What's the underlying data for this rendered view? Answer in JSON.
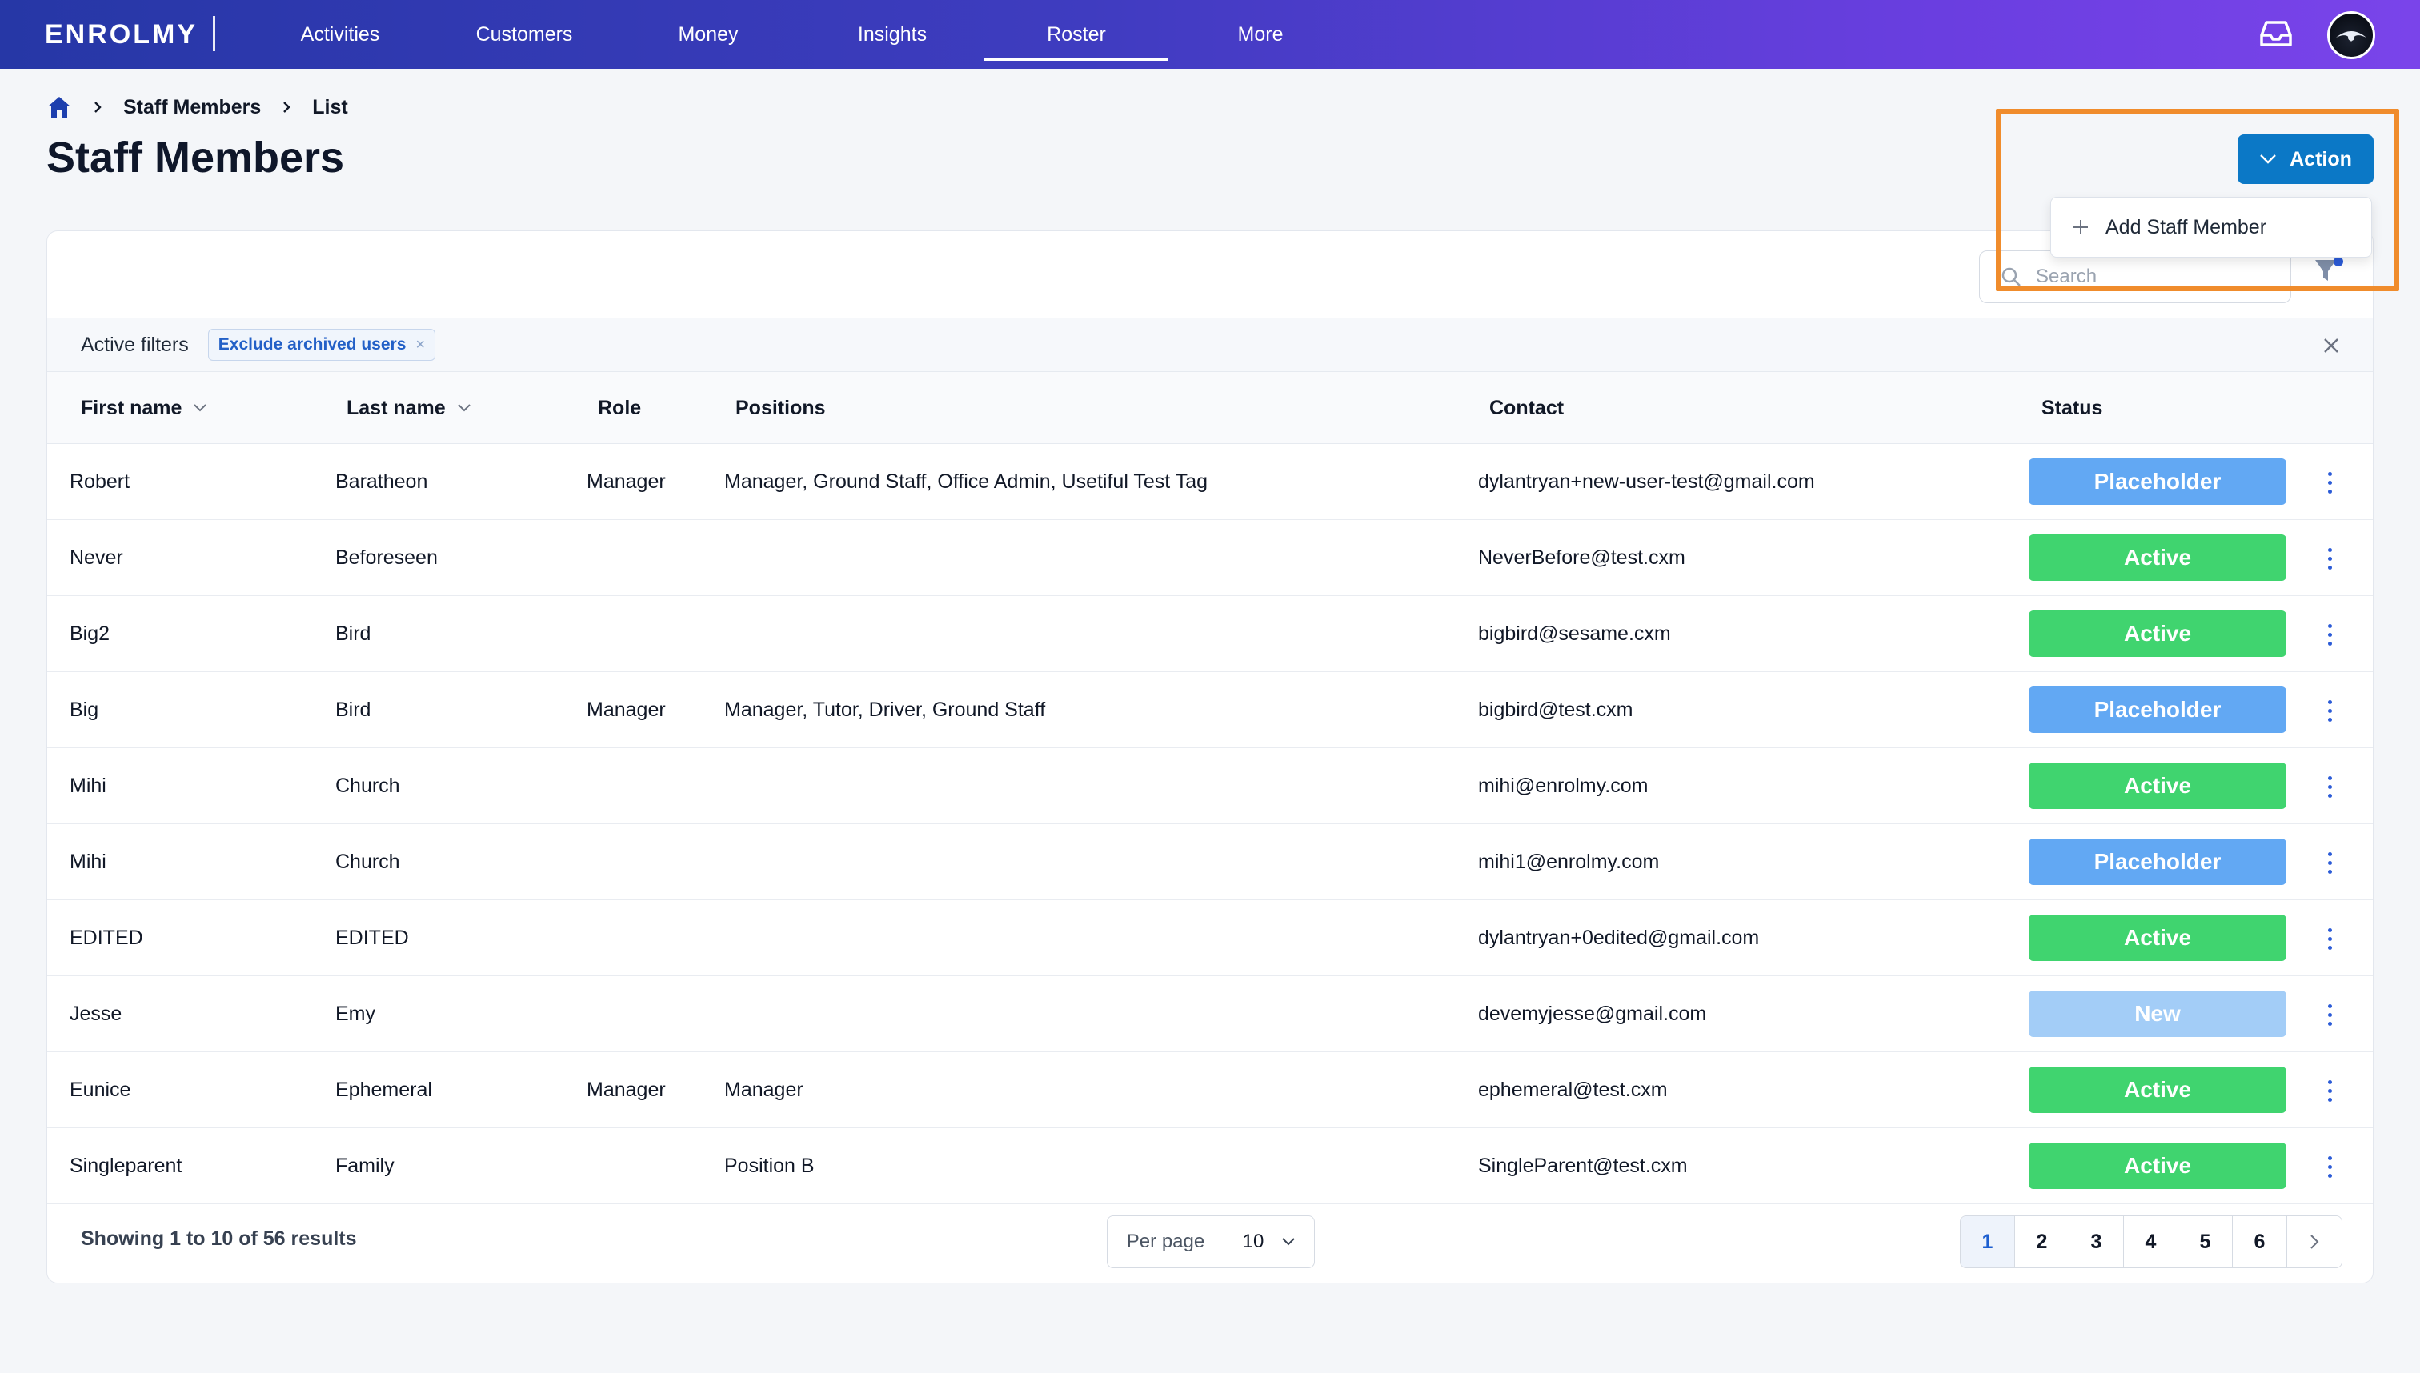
{
  "brand": {
    "logo_text": "ENROLMY"
  },
  "nav": {
    "tabs": [
      {
        "label": "Activities"
      },
      {
        "label": "Customers"
      },
      {
        "label": "Money"
      },
      {
        "label": "Insights"
      },
      {
        "label": "Roster",
        "active": true
      },
      {
        "label": "More"
      }
    ]
  },
  "breadcrumb": {
    "home_icon": "home-icon",
    "items": [
      "Staff Members",
      "List"
    ]
  },
  "page": {
    "title": "Staff Members"
  },
  "actions": {
    "button_label": "Action",
    "menu_items": [
      {
        "label": "Add Staff Member",
        "icon": "plus-icon"
      }
    ]
  },
  "search": {
    "placeholder": "Search",
    "value": ""
  },
  "filters": {
    "label": "Active filters",
    "chips": [
      {
        "label": "Exclude archived users",
        "remove": "×"
      }
    ]
  },
  "table": {
    "columns": [
      {
        "label": "First name",
        "sortable": true
      },
      {
        "label": "Last name",
        "sortable": true
      },
      {
        "label": "Role"
      },
      {
        "label": "Positions"
      },
      {
        "label": "Contact"
      },
      {
        "label": "Status"
      }
    ],
    "rows": [
      {
        "first": "Robert",
        "last": "Baratheon",
        "role": "Manager",
        "positions": "Manager, Ground Staff, Office Admin, Usetiful Test Tag",
        "contact": "dylantryan+new-user-test@gmail.com",
        "status": "Placeholder"
      },
      {
        "first": "Never",
        "last": "Beforeseen",
        "role": "",
        "positions": "",
        "contact": "NeverBefore@test.cxm",
        "status": "Active"
      },
      {
        "first": "Big2",
        "last": "Bird",
        "role": "",
        "positions": "",
        "contact": "bigbird@sesame.cxm",
        "status": "Active"
      },
      {
        "first": "Big",
        "last": "Bird",
        "role": "Manager",
        "positions": "Manager, Tutor, Driver, Ground Staff",
        "contact": "bigbird@test.cxm",
        "status": "Placeholder"
      },
      {
        "first": "Mihi",
        "last": "Church",
        "role": "",
        "positions": "",
        "contact": "mihi@enrolmy.com",
        "status": "Active"
      },
      {
        "first": "Mihi",
        "last": "Church",
        "role": "",
        "positions": "",
        "contact": "mihi1@enrolmy.com",
        "status": "Placeholder"
      },
      {
        "first": "EDITED",
        "last": "EDITED",
        "role": "",
        "positions": "",
        "contact": "dylantryan+0edited@gmail.com",
        "status": "Active"
      },
      {
        "first": "Jesse",
        "last": "Emy",
        "role": "",
        "positions": "",
        "contact": "devemyjesse@gmail.com",
        "status": "New"
      },
      {
        "first": "Eunice",
        "last": "Ephemeral",
        "role": "Manager",
        "positions": "Manager",
        "contact": "ephemeral@test.cxm",
        "status": "Active"
      },
      {
        "first": "Singleparent",
        "last": "Family",
        "role": "",
        "positions": "Position B",
        "contact": "SingleParent@test.cxm",
        "status": "Active"
      }
    ]
  },
  "status_colors": {
    "Placeholder": "#62a8f3",
    "Active": "#40d46f",
    "New": "#a3cdf7"
  },
  "footer": {
    "summary": "Showing 1 to 10 of 56 results",
    "per_page_label": "Per page",
    "per_page_value": "10",
    "pages": [
      "1",
      "2",
      "3",
      "4",
      "5",
      "6"
    ],
    "current_page": "1"
  },
  "colors": {
    "accent": "#0b78c6",
    "highlight": "#f08c2c"
  }
}
